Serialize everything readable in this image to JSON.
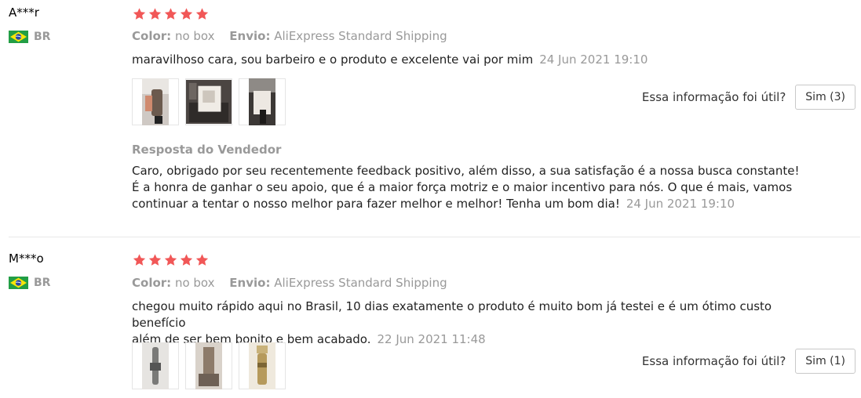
{
  "colors": {
    "star": "#f15757",
    "muted": "#999999"
  },
  "reviews": [
    {
      "user": "A***r",
      "country_code": "BR",
      "flag_icon": "brazil-flag-icon",
      "stars": 5,
      "color_key": "Color:",
      "color_value": "no box",
      "shipping_key": "Envio:",
      "shipping_value": "AliExpress Standard Shipping",
      "text": "maravilhoso cara, sou barbeiro e o produto e excelente vai por mim",
      "date": "24 Jun 2021 19:10",
      "helpful_label": "Essa informação foi útil?",
      "helpful_button": "Sim (3)",
      "reply": {
        "title": "Resposta do Vendedor",
        "lines": [
          "Caro, obrigado por seu recentemente feedback positivo, além disso, a sua satisfação é a nossa busca constante!",
          "É a honra de ganhar o seu apoio, que é a maior força motriz e o maior incentivo para nós. O que é mais, vamos",
          "continuar a tentar o nosso melhor para fazer melhor e melhor! Tenha um bom dia!"
        ],
        "date": "24 Jun 2021 19:10"
      }
    },
    {
      "user": "M***o",
      "country_code": "BR",
      "flag_icon": "brazil-flag-icon",
      "stars": 5,
      "color_key": "Color:",
      "color_value": "no box",
      "shipping_key": "Envio:",
      "shipping_value": "AliExpress Standard Shipping",
      "text_lines": [
        "chegou muito rápido aqui no Brasil, 10 dias exatamente o produto é muito bom já testei e é um ótimo custo benefício",
        "além de ser bem bonito e bem acabado."
      ],
      "date": "22 Jun 2021 11:48",
      "helpful_label": "Essa informação foi útil?",
      "helpful_button": "Sim (1)"
    }
  ]
}
